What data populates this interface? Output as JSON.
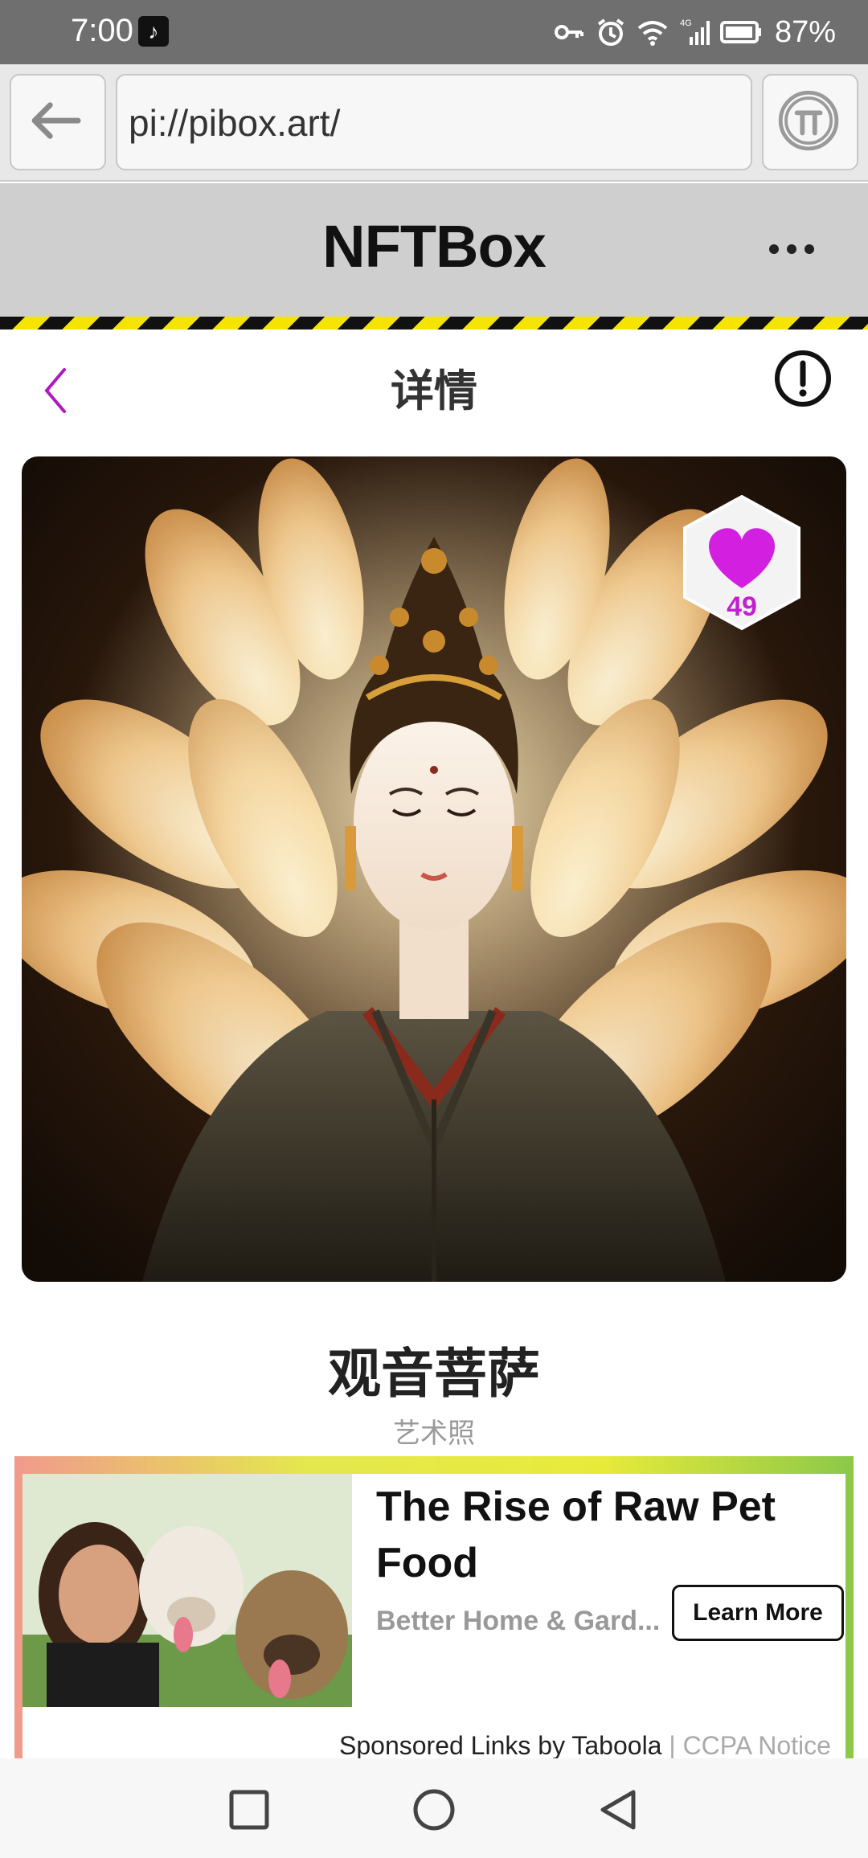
{
  "status_bar": {
    "time": "7:00",
    "battery": "87%",
    "network": "4G",
    "icons": [
      "tiktok-icon",
      "key-icon",
      "alarm-icon",
      "wifi-icon",
      "signal-icon",
      "battery-icon"
    ]
  },
  "browser": {
    "url": "pi://pibox.art/",
    "back_icon": "arrow-left-icon",
    "pi_icon": "pi-logo-icon"
  },
  "app": {
    "title": "NFTBox",
    "menu_icon": "more-dots-icon"
  },
  "detail": {
    "title": "详情",
    "back_icon": "chevron-left-icon",
    "info_icon": "exclamation-circle-icon"
  },
  "artwork": {
    "name": "观音菩萨",
    "subtitle": "艺术照",
    "likes": "49",
    "like_icon": "heart-icon"
  },
  "ad": {
    "title": "The Rise of Raw Pet Food",
    "source": "Better Home & Gard...",
    "cta": "Learn More",
    "sponsored": "Sponsored Links by Taboola",
    "separator": "|",
    "ccpa": "CCPA Notice"
  },
  "nav": {
    "icons": [
      "recents-square-icon",
      "home-circle-icon",
      "back-triangle-icon"
    ]
  },
  "colors": {
    "accent": "#c21fd1",
    "header_bg": "#cfcfcf",
    "hazard_yellow": "#f5e400"
  }
}
